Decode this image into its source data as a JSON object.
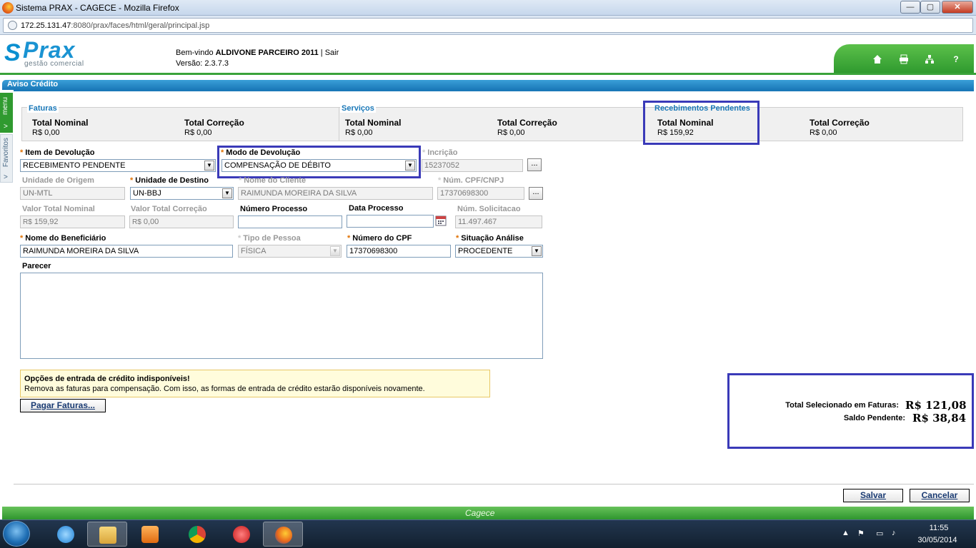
{
  "window": {
    "title": "Sistema PRAX - CAGECE - Mozilla Firefox",
    "url_host": "172.25.131.47",
    "url_path": ":8080/prax/faces/html/geral/principal.jsp",
    "min": "—",
    "max": "▢",
    "close": "✕"
  },
  "header": {
    "logo_s": "S",
    "logo_text": "Prax",
    "logo_sub": "gestão comercial",
    "welcome_prefix": "Bem-vindo",
    "user": "ALDIVONE PARCEIRO 2011",
    "logout": "Sair",
    "version": "Versão: 2.3.7.3",
    "icons": [
      "home-icon",
      "print-icon",
      "sitemap-icon",
      "help-icon"
    ]
  },
  "sidebar": {
    "menu": "menu",
    "favorites": "Favoritos"
  },
  "section": {
    "title": "Aviso Crédito"
  },
  "summary": {
    "faturas": {
      "label": "Faturas",
      "nominal_label": "Total Nominal",
      "nominal_value": "R$ 0,00",
      "correcao_label": "Total Correção",
      "correcao_value": "R$ 0,00"
    },
    "servicos": {
      "label": "Serviços",
      "nominal_label": "Total Nominal",
      "nominal_value": "R$ 0,00",
      "correcao_label": "Total Correção",
      "correcao_value": "R$ 0,00"
    },
    "recebimentos": {
      "label": "Recebimentos Pendentes",
      "nominal_label": "Total Nominal",
      "nominal_value": "R$ 159,92",
      "correcao_label": "Total Correção",
      "correcao_value": "R$ 0,00"
    }
  },
  "form": {
    "item_devolucao": {
      "label": "Item de Devolução",
      "value": "RECEBIMENTO PENDENTE"
    },
    "modo_devolucao": {
      "label": "Modo de Devolução",
      "value": "COMPENSAÇÃO DE DÉBITO"
    },
    "inscricao": {
      "label": "Incrição",
      "value": "15237052",
      "btn": "..."
    },
    "unidade_origem": {
      "label": "Unidade de Origem",
      "value": "UN-MTL"
    },
    "unidade_destino": {
      "label": "Unidade de Destino",
      "value": "UN-BBJ"
    },
    "nome_cliente": {
      "label": "Nome do Cliente",
      "value": "RAIMUNDA MOREIRA DA SILVA"
    },
    "cpf_cnpj": {
      "label": "Núm. CPF/CNPJ",
      "value": "17370698300",
      "btn": "..."
    },
    "valor_nominal": {
      "label": "Valor Total Nominal",
      "prefix": "R$",
      "value": "159,92"
    },
    "valor_correcao": {
      "label": "Valor Total Correção",
      "prefix": "R$",
      "value": "0,00"
    },
    "numero_processo": {
      "label": "Número Processo",
      "value": ""
    },
    "data_processo": {
      "label": "Data Processo",
      "value": ""
    },
    "num_solicitacao": {
      "label": "Núm. Solicitacao",
      "value": "11.497.467"
    },
    "nome_beneficiario": {
      "label": "Nome do Beneficiário",
      "value": "RAIMUNDA MOREIRA DA SILVA"
    },
    "tipo_pessoa": {
      "label": "Tipo de Pessoa",
      "value": "FÍSICA"
    },
    "numero_cpf": {
      "label": "Número do CPF",
      "value": "17370698300"
    },
    "situacao_analise": {
      "label": "Situação Análise",
      "value": "PROCEDENTE"
    },
    "parecer": {
      "label": "Parecer",
      "value": ""
    }
  },
  "warning": {
    "title": "Opções de entrada de crédito indisponíveis!",
    "text": "Remova as faturas para compensação. Com isso, as formas de entrada de crédito estarão disponíveis novamente."
  },
  "actions": {
    "pagar_faturas": "Pagar Faturas...",
    "salvar": "Salvar",
    "cancelar": "Cancelar"
  },
  "totals": {
    "selecionado_label": "Total Selecionado em Faturas:",
    "selecionado_value": "R$ 121,08",
    "saldo_label": "Saldo Pendente:",
    "saldo_value": "R$ 38,84"
  },
  "footer": {
    "brand": "Cagece"
  },
  "taskbar": {
    "time": "11:55",
    "date": "30/05/2014"
  },
  "colors": {
    "accent_blue": "#1a78b8",
    "accent_green": "#2f9a2f",
    "highlight": "#3a3ab8"
  }
}
